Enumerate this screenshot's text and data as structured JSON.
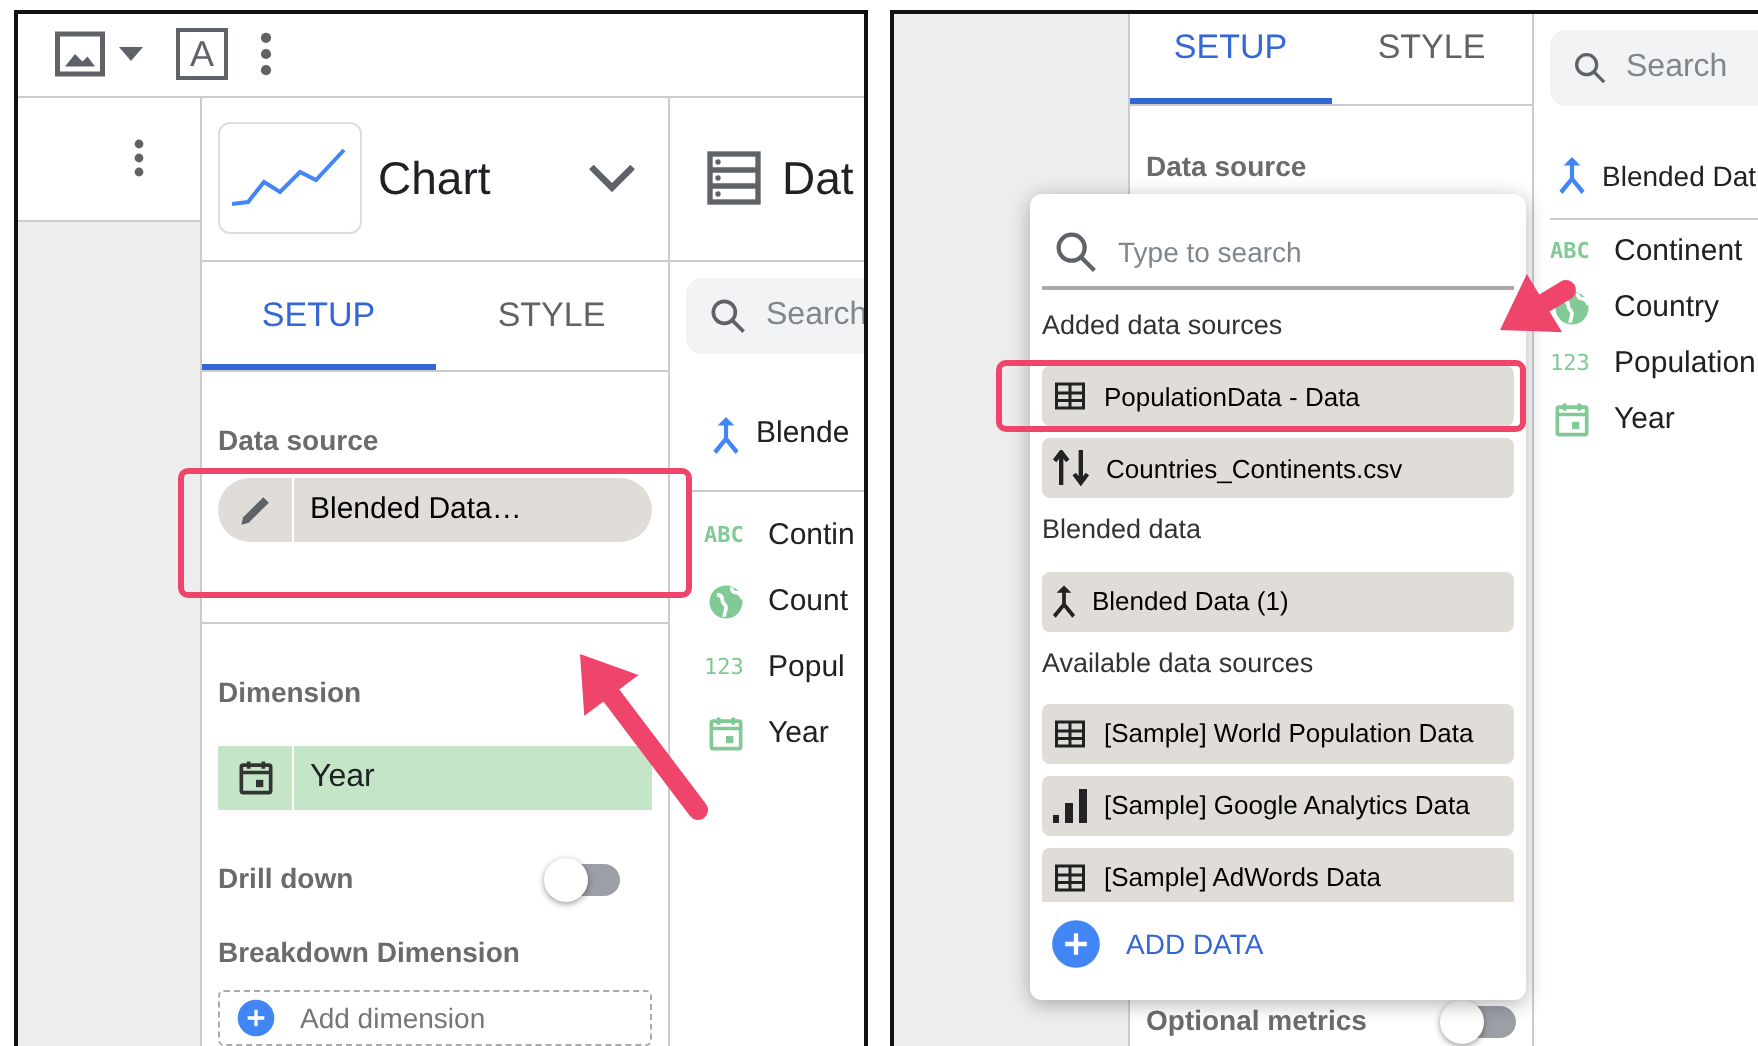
{
  "left": {
    "toolbar": {
      "text_tool": "A"
    },
    "chart_header": {
      "title": "Chart"
    },
    "tabs": [
      {
        "label": "SETUP",
        "selected": true
      },
      {
        "label": "STYLE",
        "selected": false
      }
    ],
    "data_source": {
      "label": "Data source",
      "chip": "Blended Data…",
      "highlighted": true
    },
    "dimension": {
      "label": "Dimension",
      "chip": "Year"
    },
    "drill_down": {
      "label": "Drill down",
      "on": false
    },
    "breakdown": {
      "label": "Breakdown Dimension",
      "add": "Add dimension"
    },
    "data_panel": {
      "title": "Dat",
      "search_placeholder": "Search",
      "source": "Blende",
      "fields": [
        {
          "name": "Contin",
          "kind": "text",
          "badge": "ABC"
        },
        {
          "name": "Count",
          "kind": "geo"
        },
        {
          "name": "Popul",
          "kind": "number",
          "badge": "123"
        },
        {
          "name": "Year",
          "kind": "date"
        }
      ]
    }
  },
  "right": {
    "tabs": [
      {
        "label": "SETUP",
        "selected": true
      },
      {
        "label": "STYLE",
        "selected": false
      }
    ],
    "data_source_label": "Data source",
    "optional_metrics": {
      "label": "Optional metrics",
      "on": false
    },
    "dropdown": {
      "search_placeholder": "Type to search",
      "sections": [
        {
          "heading": "Added data sources",
          "items": [
            {
              "name": "PopulationData - Data",
              "kind": "table",
              "highlighted": true
            },
            {
              "name": "Countries_Continents.csv",
              "kind": "file",
              "highlighted": false
            }
          ]
        },
        {
          "heading": "Blended data",
          "items": [
            {
              "name": "Blended Data (1)",
              "kind": "blend",
              "highlighted": false
            }
          ]
        },
        {
          "heading": "Available data sources",
          "items": [
            {
              "name": "[Sample] World Population Data",
              "kind": "table",
              "highlighted": false
            },
            {
              "name": "[Sample] Google Analytics Data",
              "kind": "analytics",
              "highlighted": false
            },
            {
              "name": "[Sample] AdWords Data",
              "kind": "table",
              "highlighted": false
            }
          ]
        }
      ],
      "add_button": "ADD DATA"
    },
    "data_panel": {
      "search_placeholder": "Search",
      "source": "Blended Dat",
      "fields": [
        {
          "name": "Continent",
          "kind": "text",
          "badge": "ABC"
        },
        {
          "name": "Country",
          "kind": "geo"
        },
        {
          "name": "Population",
          "kind": "number",
          "badge": "123"
        },
        {
          "name": "Year",
          "kind": "date"
        }
      ]
    }
  }
}
